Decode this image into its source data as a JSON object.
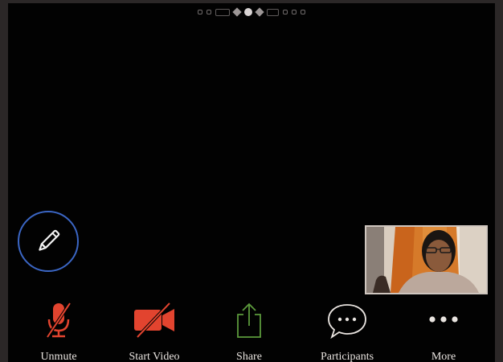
{
  "toolbar": {
    "items": [
      {
        "label": "Unmute",
        "icon": "muted-microphone-icon"
      },
      {
        "label": "Start Video",
        "icon": "video-off-icon"
      },
      {
        "label": "Share",
        "icon": "share-icon"
      },
      {
        "label": "Participants",
        "icon": "chat-bubble-icon"
      },
      {
        "label": "More",
        "icon": "more-dots-icon"
      }
    ]
  },
  "colors": {
    "background": "#020202",
    "accent_blue": "#3b66c4",
    "muted_red": "#e2442f",
    "share_green": "#5c9a3c",
    "label_text": "#e9e4e0"
  }
}
